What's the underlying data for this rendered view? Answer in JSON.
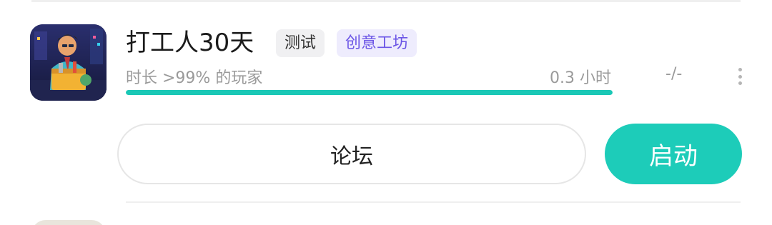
{
  "game": {
    "title": "打工人30天",
    "tags": [
      "测试",
      "创意工坊"
    ],
    "playtime_text": "时长 >99% 的玩家",
    "hours_text": "0.3 小时",
    "rating_text": "-/-",
    "progress_fraction": 1.0,
    "icon_name": "game-cover-icon"
  },
  "actions": {
    "forum_label": "论坛",
    "launch_label": "启动"
  },
  "colors": {
    "accent": "#1dccb9",
    "workshop_tag_text": "#6b55e6",
    "workshop_tag_bg": "#eeecfd"
  }
}
